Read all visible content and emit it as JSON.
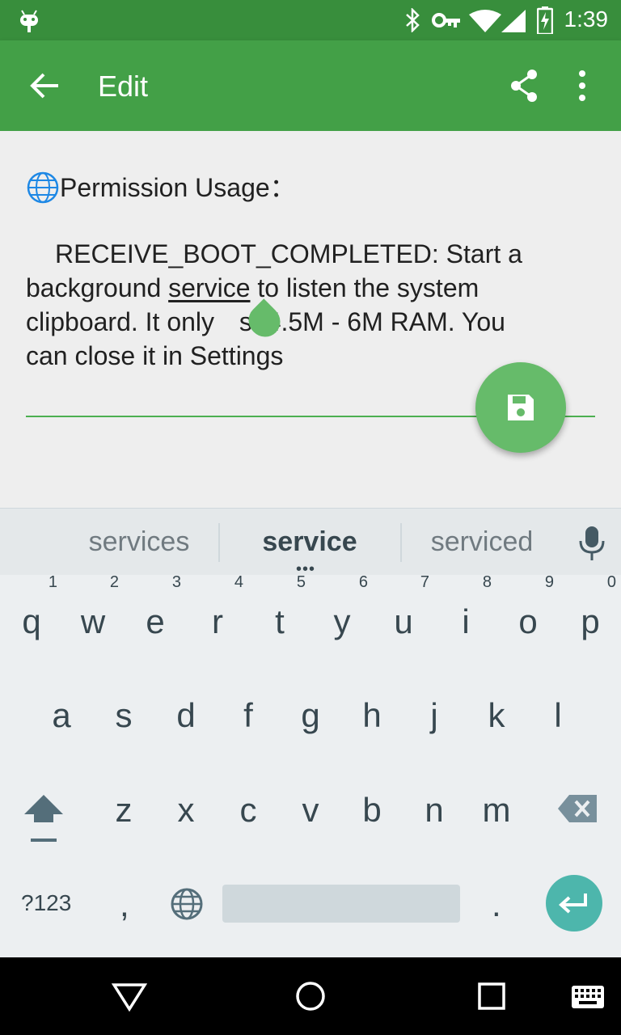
{
  "status_bar": {
    "time": "1:39",
    "icons": [
      "android-icon",
      "bluetooth-icon",
      "vpn-key-icon",
      "wifi-icon",
      "signal-icon",
      "battery-charging-icon"
    ]
  },
  "app_bar": {
    "title": "Edit",
    "back_icon": "arrow-back-icon",
    "share_icon": "share-icon",
    "menu_icon": "more-vert-icon"
  },
  "editor": {
    "heading_icon": "globe-icon",
    "heading": "Permission Usage：",
    "text_before": "RECEIVE_BOOT_COMPLETED:  Start a background ",
    "text_underlined": "service",
    "text_line2_rest": " to listen the system",
    "text_line3_a": "clipboard. It only ",
    "text_line3_b": "st 4.5M - 6M RAM. You",
    "text_line4": "can close it in Settings",
    "accent_color": "#4CAF50"
  },
  "fab": {
    "icon": "save-icon",
    "color": "#66BB6A"
  },
  "keyboard": {
    "suggestions": [
      "services",
      "service",
      "serviced"
    ],
    "row1": [
      {
        "k": "q",
        "n": "1"
      },
      {
        "k": "w",
        "n": "2"
      },
      {
        "k": "e",
        "n": "3"
      },
      {
        "k": "r",
        "n": "4"
      },
      {
        "k": "t",
        "n": "5"
      },
      {
        "k": "y",
        "n": "6"
      },
      {
        "k": "u",
        "n": "7"
      },
      {
        "k": "i",
        "n": "8"
      },
      {
        "k": "o",
        "n": "9"
      },
      {
        "k": "p",
        "n": "0"
      }
    ],
    "row2": [
      "a",
      "s",
      "d",
      "f",
      "g",
      "h",
      "j",
      "k",
      "l"
    ],
    "row3": [
      "z",
      "x",
      "c",
      "v",
      "b",
      "n",
      "m"
    ],
    "symbols_label": "?123",
    "comma": ",",
    "period": ".",
    "enter_color": "#4DB6AC"
  },
  "nav_bar": {
    "icons": [
      "back-triangle-icon",
      "home-circle-icon",
      "recents-square-icon",
      "keyboard-icon"
    ]
  }
}
